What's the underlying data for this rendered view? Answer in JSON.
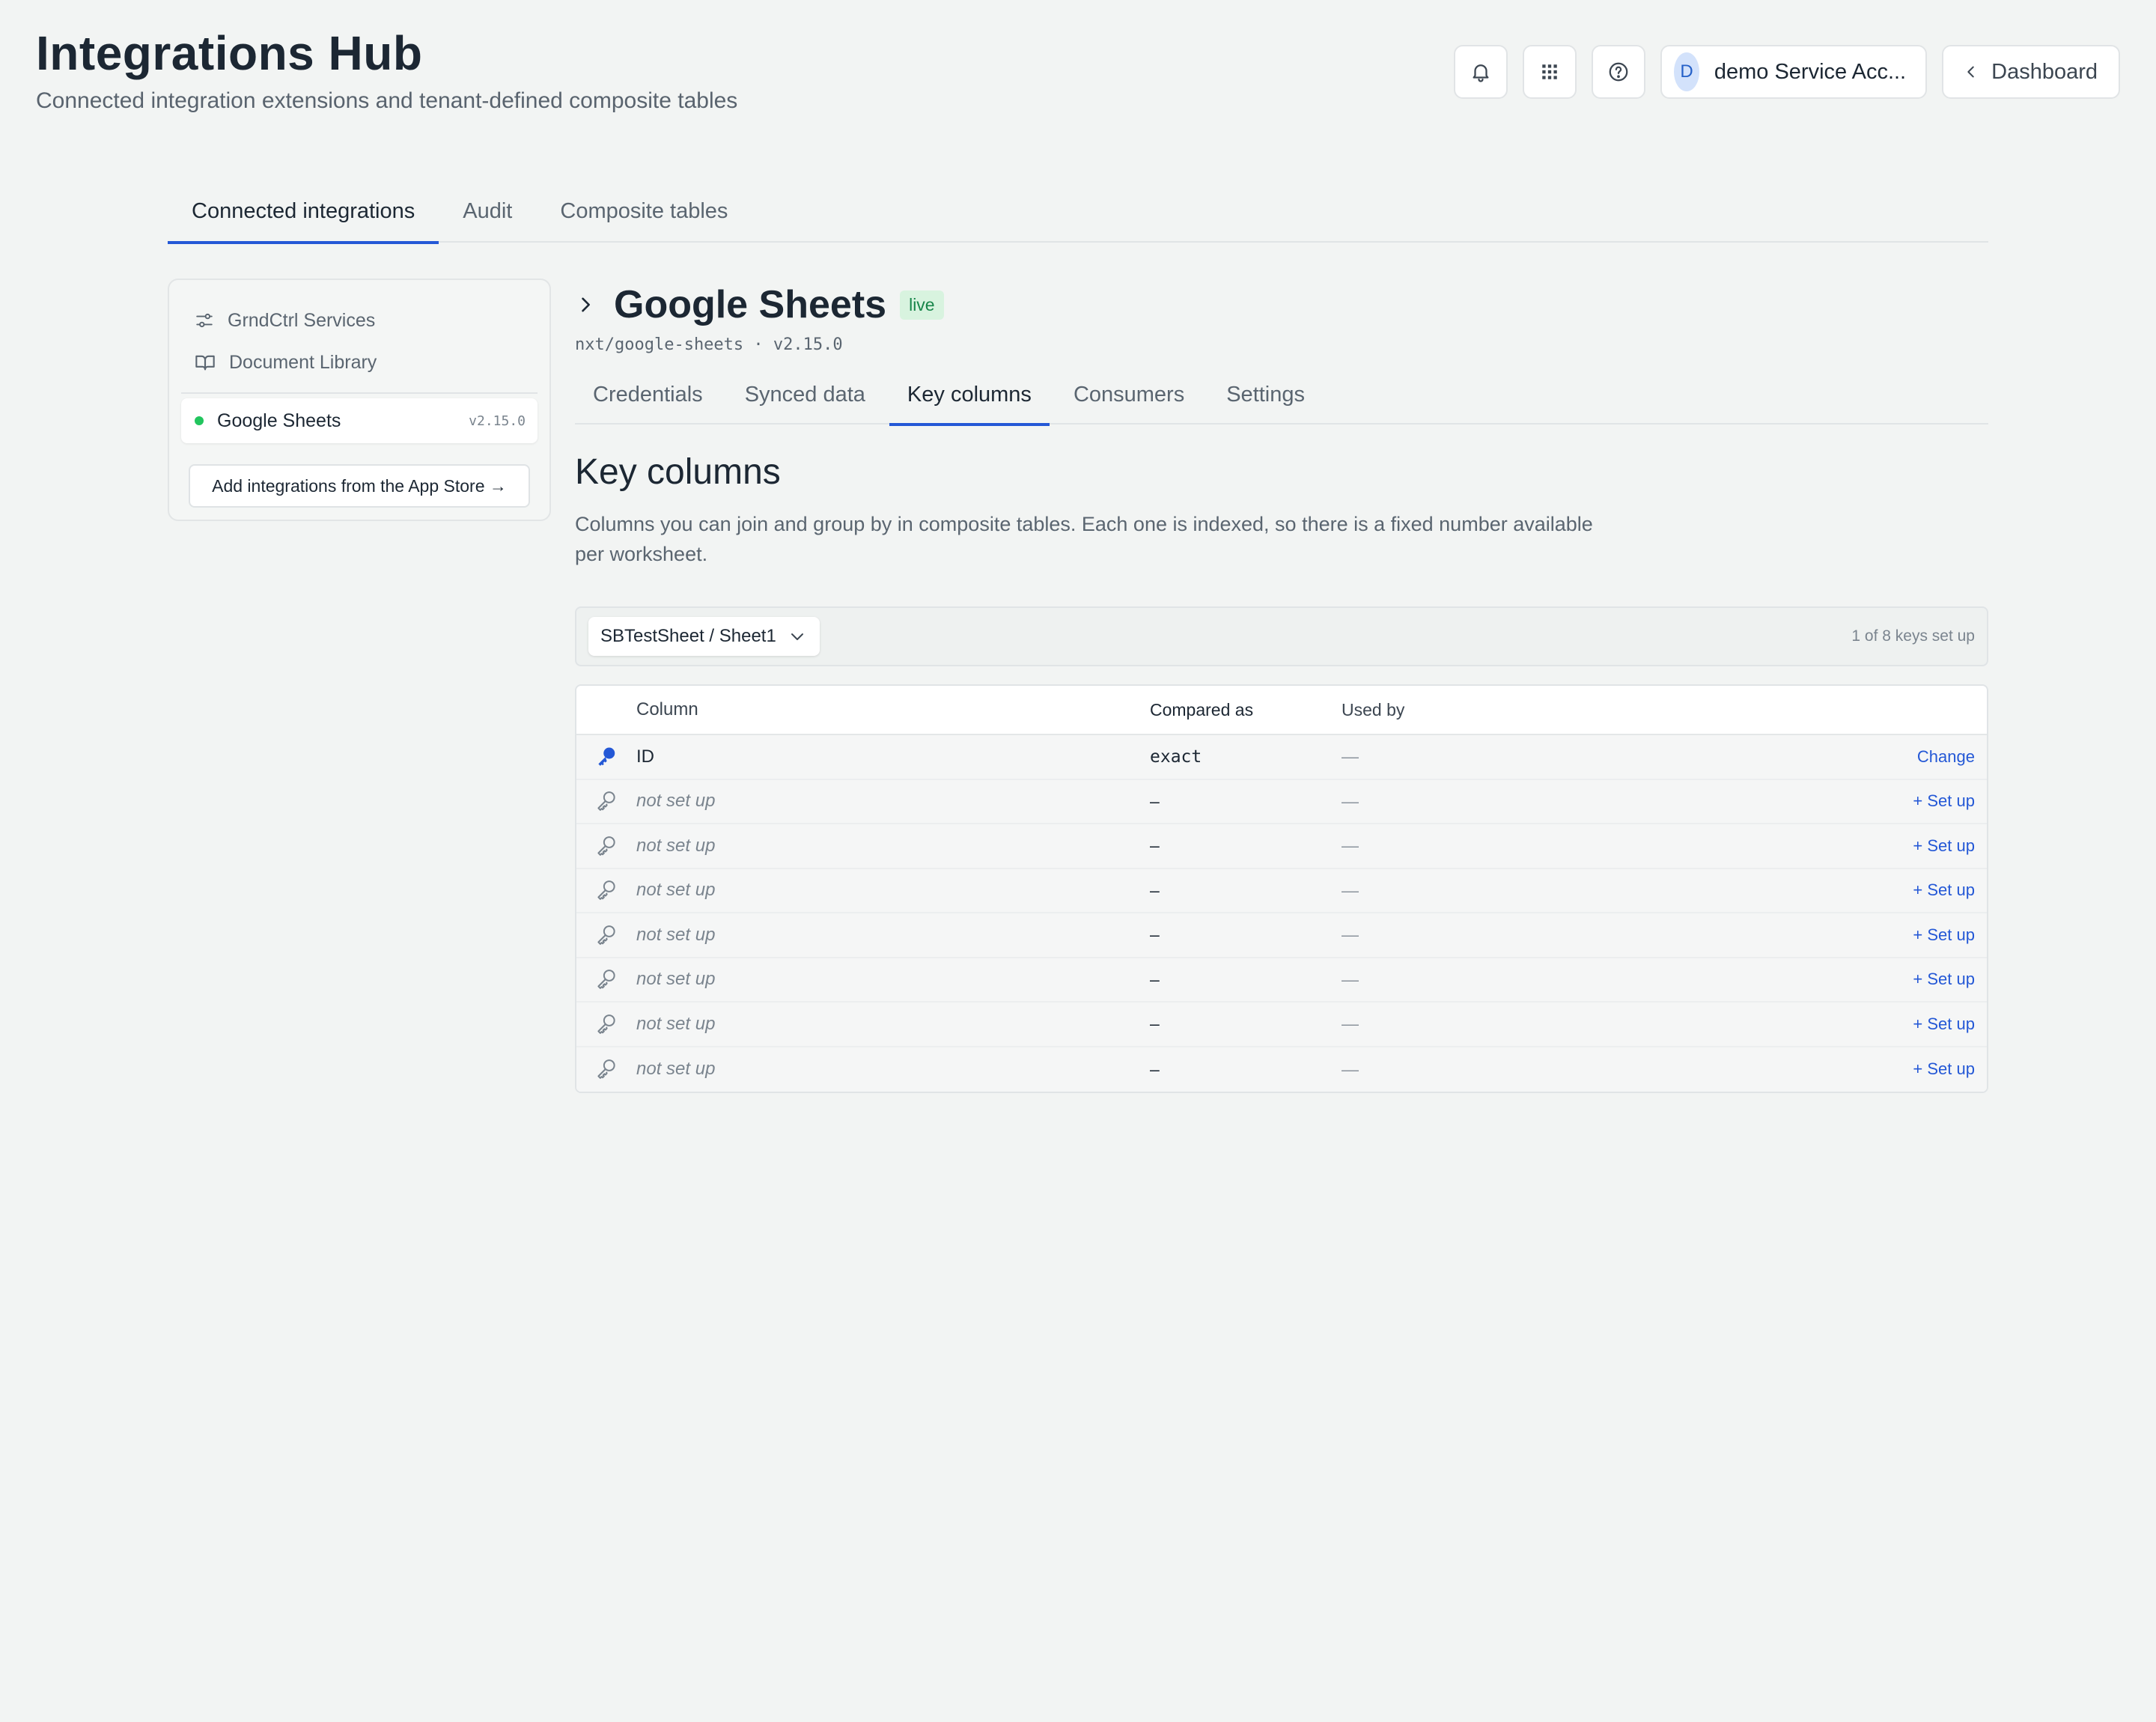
{
  "header": {
    "title": "Integrations Hub",
    "subtitle": "Connected integration extensions and tenant-defined composite tables"
  },
  "top_actions": {
    "notifications_icon": "bell-icon",
    "apps_icon": "grid-icon",
    "help_icon": "question-icon",
    "user_initial": "D",
    "user_name": "demo Service Acc...",
    "dashboard_label": "Dashboard"
  },
  "top_tabs": [
    {
      "label": "Connected integrations",
      "active": true
    },
    {
      "label": "Audit",
      "active": false
    },
    {
      "label": "Composite tables",
      "active": false
    }
  ],
  "sidebar": {
    "items": [
      {
        "label": "GrndCtrl Services",
        "icon": "sliders-icon"
      },
      {
        "label": "Document Library",
        "icon": "book-icon"
      }
    ],
    "active": {
      "label": "Google Sheets",
      "version": "v2.15.0",
      "status_color": "#22c55e"
    },
    "add_button": "Add integrations from the App Store →"
  },
  "integration": {
    "name": "Google Sheets",
    "status": "live",
    "path": "nxt/google-sheets · v2.15.0"
  },
  "sub_tabs": [
    {
      "label": "Credentials",
      "active": false
    },
    {
      "label": "Synced data",
      "active": false
    },
    {
      "label": "Key columns",
      "active": true
    },
    {
      "label": "Consumers",
      "active": false
    },
    {
      "label": "Settings",
      "active": false
    }
  ],
  "key_columns": {
    "title": "Key columns",
    "description": "Columns you can join and group by in composite tables. Each one is indexed, so there is a fixed number available per worksheet.",
    "sheet_selector": "SBTestSheet / Sheet1",
    "keys_count": "1 of 8 keys set up",
    "table": {
      "headers": [
        "Column",
        "Compared as",
        "Used by"
      ],
      "rows": [
        {
          "column": "ID",
          "compared_as": "exact",
          "used_by": "—",
          "action": "Change",
          "set": true
        },
        {
          "column": "not set up",
          "compared_as": "–",
          "used_by": "—",
          "action": "+ Set up",
          "set": false
        },
        {
          "column": "not set up",
          "compared_as": "–",
          "used_by": "—",
          "action": "+ Set up",
          "set": false
        },
        {
          "column": "not set up",
          "compared_as": "–",
          "used_by": "—",
          "action": "+ Set up",
          "set": false
        },
        {
          "column": "not set up",
          "compared_as": "–",
          "used_by": "—",
          "action": "+ Set up",
          "set": false
        },
        {
          "column": "not set up",
          "compared_as": "–",
          "used_by": "—",
          "action": "+ Set up",
          "set": false
        },
        {
          "column": "not set up",
          "compared_as": "–",
          "used_by": "—",
          "action": "+ Set up",
          "set": false
        },
        {
          "column": "not set up",
          "compared_as": "–",
          "used_by": "—",
          "action": "+ Set up",
          "set": false
        }
      ]
    }
  },
  "colors": {
    "accent": "#2458d6",
    "live_bg": "#d8f3df",
    "live_text": "#18864a"
  }
}
